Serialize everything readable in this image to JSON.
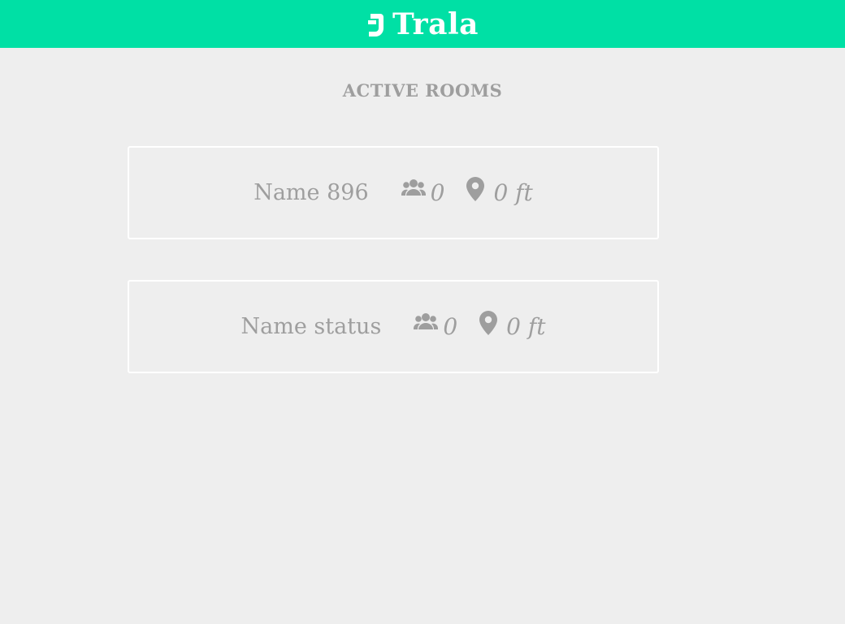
{
  "app": {
    "brand": "Trala",
    "brand_color": "#00e0a5"
  },
  "rooms_section": {
    "title": "ACTIVE ROOMS"
  },
  "rooms": [
    {
      "name": "Name 896",
      "people": "0",
      "distance": "0 ft",
      "people_icon": "group-icon",
      "distance_icon": "map-pin-icon"
    },
    {
      "name": "Name status",
      "people": "0",
      "distance": "0 ft",
      "people_icon": "group-icon",
      "distance_icon": "map-pin-icon"
    }
  ]
}
